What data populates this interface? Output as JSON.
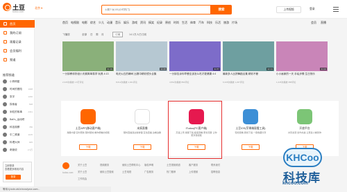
{
  "header": {
    "logo_text": "土豆",
    "logo_sub": "tudou.com",
    "region_label": "北京 ▾",
    "search_placeholder": "火箭少女101(小时热门)",
    "search_label": "搜索",
    "upload_label": "上传视频",
    "login_label": "登录"
  },
  "nav": {
    "items": [
      "首页",
      "电视剧",
      "电影",
      "综艺",
      "少儿",
      "动漫",
      "音乐",
      "娱乐",
      "游戏",
      "资讯",
      "搞笑",
      "纪录",
      "原创",
      "时尚",
      "生活",
      "体育",
      "汽车",
      "科技",
      "乐活",
      "旅游",
      "片场"
    ],
    "right": [
      "会员",
      "直播"
    ]
  },
  "sidebar": {
    "items": [
      {
        "label": "首页",
        "active": true
      },
      {
        "label": "我的订阅",
        "active": false
      },
      {
        "label": "观看记录",
        "active": false
      },
      {
        "label": "会员福利",
        "active": false
      },
      {
        "label": "频道",
        "active": false
      }
    ],
    "section_title": "推荐频道",
    "channels": [
      {
        "name": "小狗明星",
        "count": ""
      },
      {
        "name": "时间的冒险",
        "count": "1028"
      },
      {
        "name": "张宇",
        "count": "1230"
      },
      {
        "name": "探索者",
        "count": "508"
      },
      {
        "name": "米粒的故事",
        "count": "2341"
      },
      {
        "name": "Ball's_运动吧",
        "count": ""
      },
      {
        "name": "科技观察",
        "count": "786"
      },
      {
        "name": "中二频道",
        "count": "1145"
      },
      {
        "name": "料理大师",
        "count": "905"
      },
      {
        "name": "奇葩说",
        "count": "2.3万"
      }
    ],
    "login_prompt_line1": "立即登录",
    "login_prompt_line2": "查看更多精彩内容",
    "login_button": "登录"
  },
  "filter": {
    "tags": [
      "飞播放",
      "全部",
      "日",
      "周",
      "月",
      "订阅",
      "14.1万人已订阅"
    ],
    "active_index": 5
  },
  "videos": [
    {
      "title": "一分钟教你折纸小天鹅简单易学 玩具 4:13",
      "meta": "2,345次播放  1.6万评论",
      "duration": "01:19",
      "thumb_color": "#8ab07a"
    },
    {
      "title": "电光火石的瞬间 比赛中精彩镜头合集",
      "meta": "8,612次播放  1,021评论",
      "duration": "02:45",
      "thumb_color": "#b6c8d2"
    },
    {
      "title": "一分钟告诉你早餐应该怎么吃才更健康 4:4",
      "meta": "4,562次播放  862评论",
      "duration": "01:57",
      "thumb_color": "#7d6cc9"
    },
    {
      "title": "最新多人比拼舞蹈合集 精彩不断",
      "meta": "6,345次播放  1,237评论",
      "duration": "02:13",
      "thumb_color": "#6e9fa0"
    },
    {
      "title": "小小画家的一天 手绘步骤 生日快乐",
      "meta": "1,245次播放  358评论",
      "duration": "01:02",
      "thumb_color": "#c985b8"
    }
  ],
  "apps": [
    {
      "name": "土豆APP(移动客户端)",
      "desc": "海量内容 实时更新 随时随地 看你想看的视频",
      "button": "下载",
      "color": "#ff6600",
      "icon": "tudou-app-icon"
    },
    {
      "name": "米疯直播",
      "desc": "随时直播身边新鲜事 互动直播 边看边聊",
      "button": "下载",
      "color": "#ffffff",
      "icon": "mifeng-app-icon"
    },
    {
      "name": "iTudou(PC客户端)",
      "desc": "高速上传,海量下载,极速观看,更省流量 让你更享受视频",
      "button": "下载",
      "color": "#e6194f",
      "icon": "itudou-app-icon"
    },
    {
      "name": "土豆iOS(苹果端观看工具)",
      "desc": "轻松观看,离线下载,一键收藏分享",
      "button": "下载",
      "color": "#3d8fd6",
      "icon": "ios-app-icon"
    },
    {
      "name": "开放平台",
      "desc": "共享资源 合作共赢 让更多人看到你",
      "button": "下载",
      "color": "#7cc576",
      "icon": "open-platform-icon"
    }
  ],
  "footer": {
    "brand": "tudou.com",
    "row1": [
      "关于土豆",
      "视频服务",
      "使用土豆帮助中心",
      "版权声明",
      "土豆视频频道",
      "客户服务",
      "联系我们"
    ],
    "row2": [
      "关于土豆",
      "使用土豆搜索",
      "土豆电视",
      "广告服务",
      "热门推荐",
      "上传视频",
      "招聘信息"
    ],
    "row3": [
      "工作机会"
    ]
  },
  "watermark": {
    "bubble": "KHCoo",
    "title": "科技库",
    "url": "khcoo.com"
  },
  "status_bar": {
    "text": "等待 tj.tcdn.vid.lr/xxxx/yxxx.com..."
  }
}
